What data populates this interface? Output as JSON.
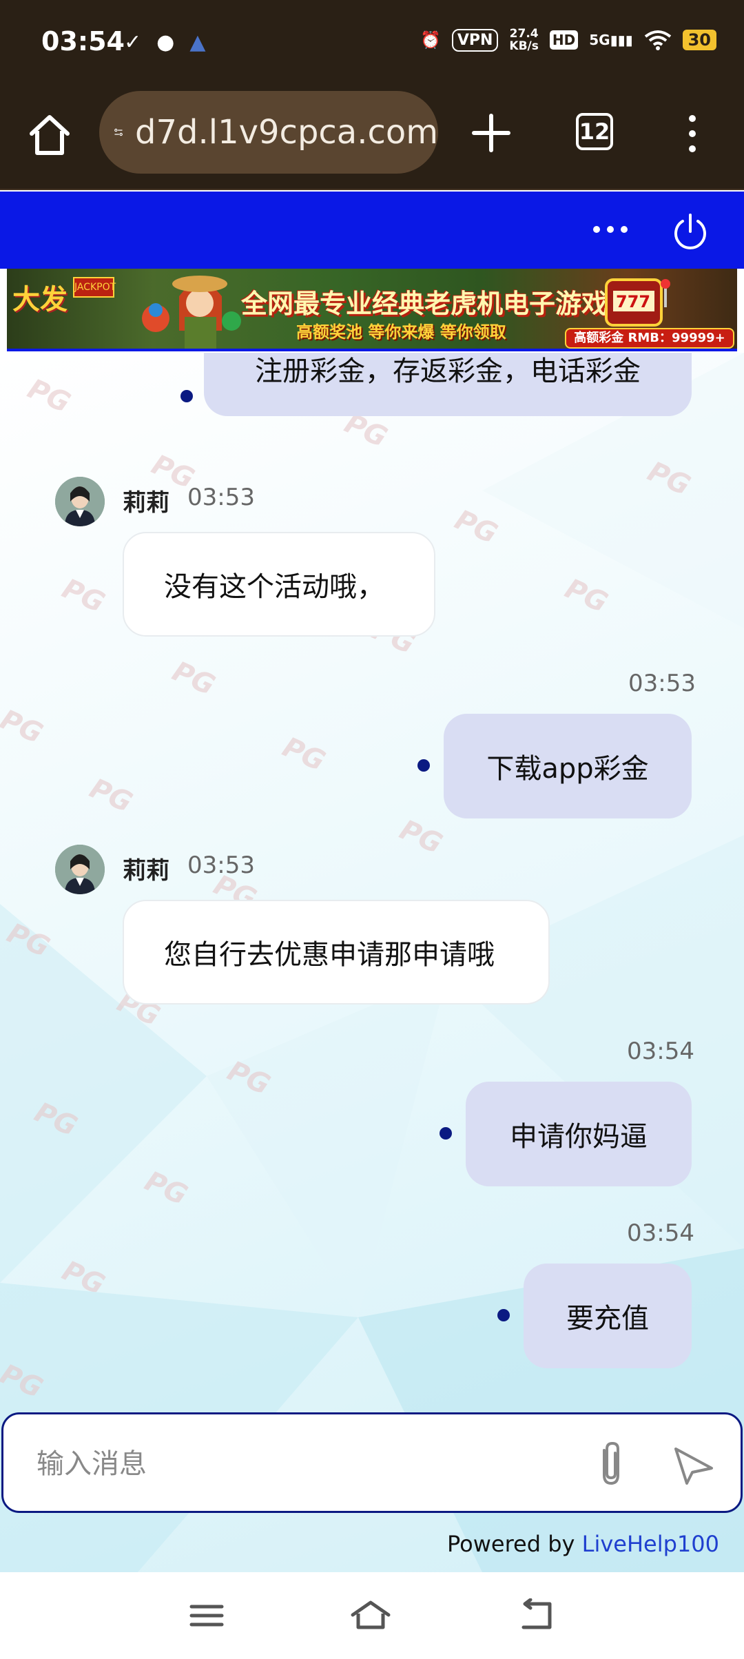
{
  "status_bar": {
    "time": "03:54",
    "vpn": "VPN",
    "speed_value": "27.4",
    "speed_unit": "KB/s",
    "hd": "HD",
    "network": "5G",
    "battery": "30"
  },
  "browser": {
    "url": "d7d.l1v9cpca.com",
    "tab_count": "12"
  },
  "banner": {
    "logo": "大发",
    "jackpot": "JACKPOT",
    "title": "全网最专业经典老虎机电子游戏",
    "subtitle": "高额奖池 等你来爆 等你领取",
    "prize": "高额彩金 RMB：99999+"
  },
  "messages": [
    {
      "type": "out",
      "text": "注册彩金，存返彩金，电话彩金"
    },
    {
      "type": "in",
      "sender": "莉莉",
      "time": "03:53",
      "text": "没有这个活动哦，"
    },
    {
      "type": "out",
      "time": "03:53",
      "text": "下载app彩金"
    },
    {
      "type": "in",
      "sender": "莉莉",
      "time": "03:53",
      "text": "您自行去优惠申请那申请哦"
    },
    {
      "type": "out",
      "time": "03:54",
      "text": "申请你妈逼"
    },
    {
      "type": "out",
      "time": "03:54",
      "text": "要充值"
    }
  ],
  "input": {
    "placeholder": "输入消息"
  },
  "footer": {
    "powered_by": "Powered by ",
    "brand": "LiveHelp100"
  },
  "icons": {
    "home": "home-icon",
    "site_settings": "tune-icon",
    "new_tab": "plus-icon",
    "tabs": "tabs-icon",
    "menu": "more-vert-icon",
    "chat_more": "more-horiz-icon",
    "power": "power-icon",
    "attach": "paperclip-icon",
    "send": "send-icon"
  },
  "colors": {
    "header_blue": "#0a18e6",
    "bubble_out": "#d9ddf3",
    "dot": "#0b1a82",
    "link": "#1f3fcf",
    "browser_bg": "#2a2015"
  }
}
